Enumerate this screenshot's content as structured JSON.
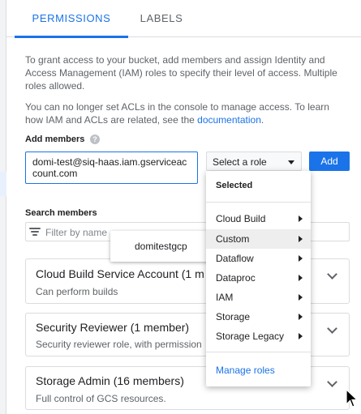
{
  "tabs": [
    {
      "label": "PERMISSIONS",
      "active": true
    },
    {
      "label": "LABELS",
      "active": false
    }
  ],
  "intro_text": "To grant access to your bucket, add members and assign Identity and Access Management (IAM) roles to specify their level of access. Multiple roles allowed.",
  "acl_text": "You can no longer set ACLs in the console to manage access. To learn how IAM and ACLs are related, see the",
  "acl_link": "documentation",
  "acl_end": ".",
  "add_members": {
    "label": "Add members",
    "help_icon": "help-icon",
    "input_value": "domi-test@siq-haas.iam.gserviceaccount.com",
    "role_select": "Select a role",
    "add_button": "Add"
  },
  "search_members": {
    "label": "Search members",
    "placeholder": "Filter by name"
  },
  "suggestion": "domitestgcp",
  "role_menu": {
    "selected_header": "Selected",
    "items": [
      "Cloud Build",
      "Custom",
      "Dataflow",
      "Dataproc",
      "IAM",
      "Storage",
      "Storage Legacy"
    ],
    "hovered": "Custom",
    "manage_roles": "Manage roles"
  },
  "member_cards": [
    {
      "title": "Cloud Build Service Account (1 m",
      "description": "Can perform builds"
    },
    {
      "title": "Security Reviewer (1 member)",
      "description": "Security reviewer role, with permission"
    },
    {
      "title": "Storage Admin (16 members)",
      "description": "Full control of GCS resources."
    }
  ],
  "colors": {
    "accent": "#1a73e8",
    "text": "#202124",
    "muted": "#5f6368",
    "border": "#dadce0"
  }
}
